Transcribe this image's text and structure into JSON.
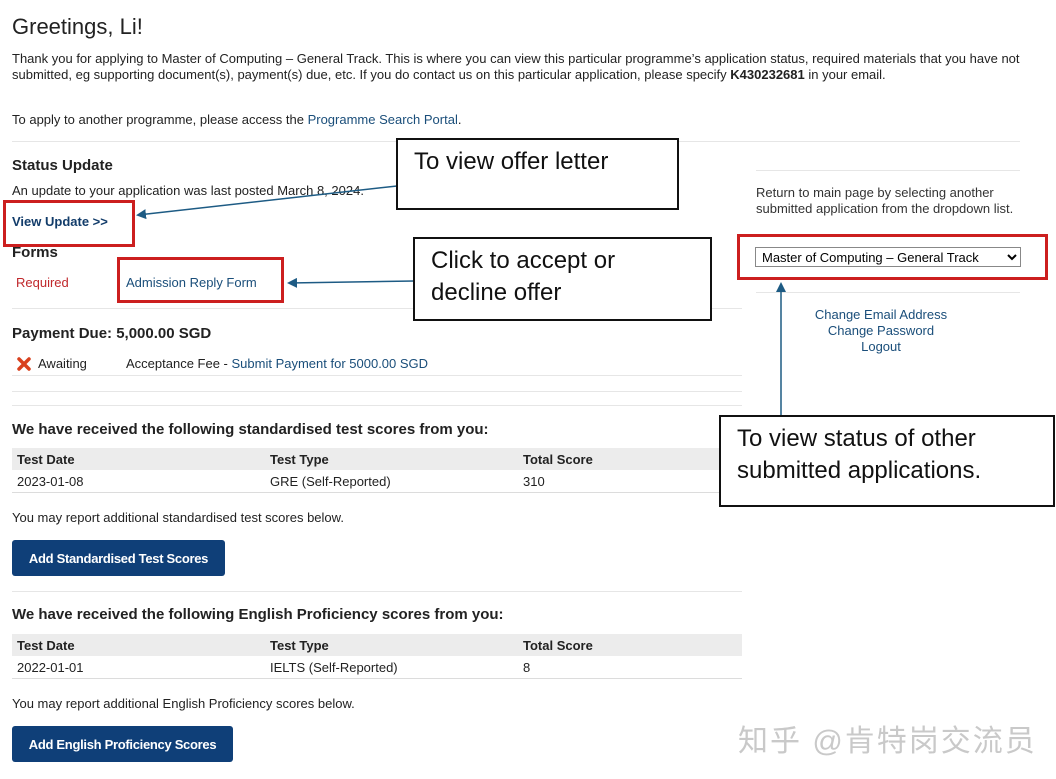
{
  "greeting": "Greetings, Li!",
  "intro": {
    "text_before": "Thank you for applying to Master of Computing – General Track. This is where you can view this particular programme’s application status, required materials that you have not submitted, eg supporting document(s), payment(s) due, etc. If you do contact us on this particular application, please specify ",
    "app_id": "K430232681",
    "text_after": " in your email."
  },
  "apply_another": {
    "text": "To apply to another programme, please access the ",
    "link": "Programme Search Portal",
    "end": "."
  },
  "status": {
    "title": "Status Update",
    "text": "An update to your application was last posted March 8, 2024.",
    "view_update": "View Update >>"
  },
  "forms": {
    "title": "Forms",
    "status": "Required",
    "link": "Admission Reply Form"
  },
  "payment": {
    "title": "Payment Due: 5,000.00 SGD",
    "status": "Awaiting",
    "item": "Acceptance Fee - ",
    "link": "Submit Payment for 5000.00 SGD"
  },
  "std_tests": {
    "title": "We have received the following standardised test scores from you:",
    "headers": [
      "Test Date",
      "Test Type",
      "Total Score"
    ],
    "rows": [
      [
        "2023-01-08",
        "GRE (Self-Reported)",
        "310"
      ]
    ],
    "note": "You may report additional standardised test scores below.",
    "button": "Add Standardised Test Scores"
  },
  "english": {
    "title": "We have received the following English Proficiency scores from you:",
    "headers": [
      "Test Date",
      "Test Type",
      "Total Score"
    ],
    "rows": [
      [
        "2022-01-01",
        "IELTS (Self-Reported)",
        "8"
      ]
    ],
    "note": "You may report additional English Proficiency scores below.",
    "button": "Add English Proficiency Scores"
  },
  "sidebar": {
    "text": "Return to main page by selecting another submitted application from the dropdown list.",
    "selected_app": "Master of Computing – General Track",
    "links": [
      "Change Email Address",
      "Change Password",
      "Logout"
    ]
  },
  "callouts": {
    "offer": "To view offer letter",
    "accept": "Click to accept or decline offer",
    "status": "To view status of other submitted applications."
  },
  "watermark": "知乎 @肯特岗交流员",
  "colors": {
    "link": "#1a4e7a",
    "button": "#0f3f78",
    "required": "#c0282c",
    "highlight_box": "#cc1f1f",
    "arrow": "#1d5b84"
  },
  "icons": {
    "awaiting": "x-mark-icon"
  }
}
